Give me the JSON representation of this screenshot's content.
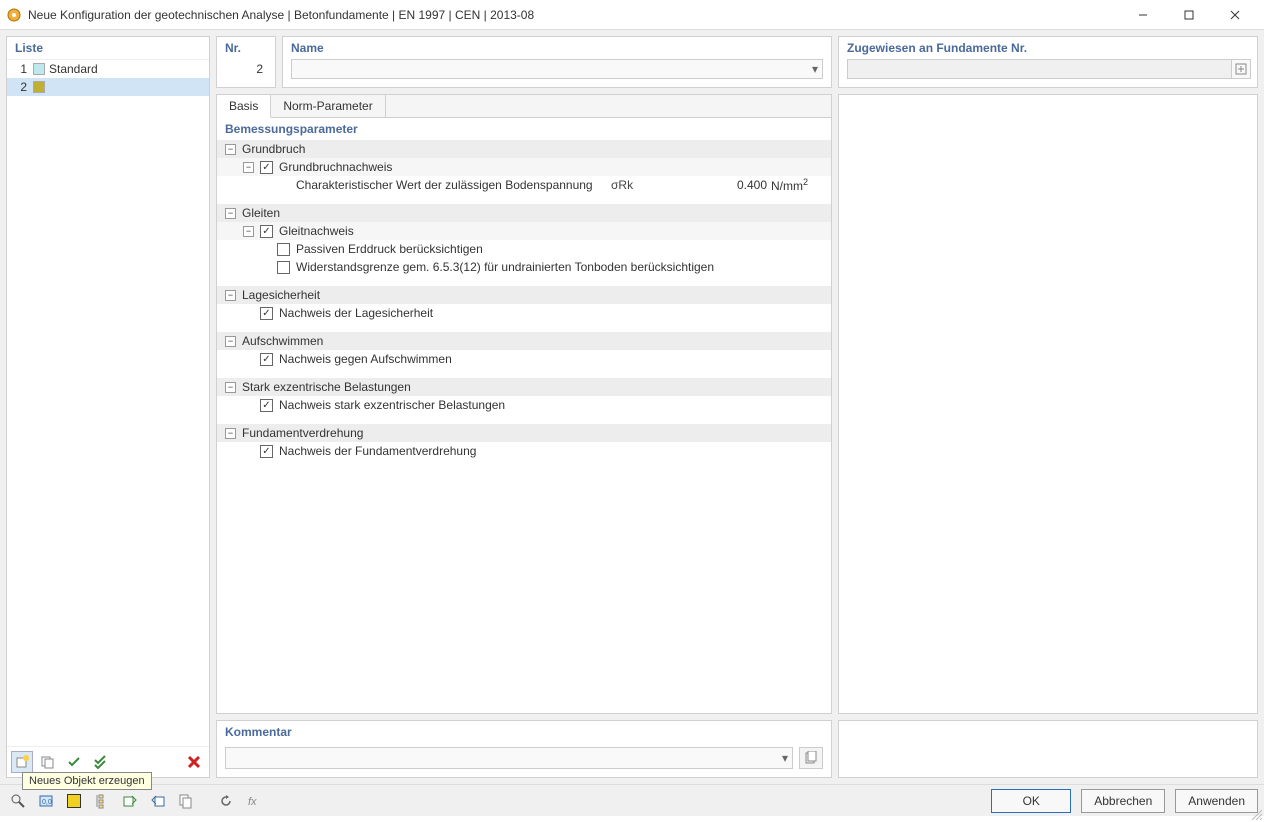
{
  "window": {
    "title": "Neue Konfiguration der geotechnischen Analyse | Betonfundamente | EN 1997 | CEN | 2013-08"
  },
  "sidebar": {
    "heading": "Liste",
    "items": [
      {
        "num": "1",
        "name": "Standard",
        "color": "#bfe8ee"
      },
      {
        "num": "2",
        "name": "",
        "color": "#c0b030"
      }
    ],
    "tooltip": "Neues Objekt erzeugen"
  },
  "header": {
    "nr_label": "Nr.",
    "nr_value": "2",
    "name_label": "Name",
    "name_value": "",
    "assigned_label": "Zugewiesen an Fundamente Nr.",
    "assigned_value": ""
  },
  "tabs": {
    "basis": "Basis",
    "norm": "Norm-Parameter"
  },
  "params": {
    "section_title": "Bemessungsparameter",
    "groups": [
      {
        "title": "Grundbruch",
        "rows": [
          {
            "type": "check",
            "checked": true,
            "label": "Grundbruchnachweis",
            "hasChildren": true
          },
          {
            "type": "value",
            "label": "Charakteristischer Wert der zulässigen Bodenspannung",
            "symbol": "σRk",
            "value": "0.400",
            "unit": "N/mm²"
          }
        ]
      },
      {
        "title": "Gleiten",
        "rows": [
          {
            "type": "check",
            "checked": true,
            "label": "Gleitnachweis",
            "hasChildren": true
          },
          {
            "type": "check",
            "checked": false,
            "label": "Passiven Erddruck berücksichtigen"
          },
          {
            "type": "check",
            "checked": false,
            "label": "Widerstandsgrenze gem. 6.5.3(12) für undrainierten Tonboden berücksichtigen"
          }
        ]
      },
      {
        "title": "Lagesicherheit",
        "rows": [
          {
            "type": "check",
            "checked": true,
            "label": "Nachweis der Lagesicherheit"
          }
        ]
      },
      {
        "title": "Aufschwimmen",
        "rows": [
          {
            "type": "check",
            "checked": true,
            "label": "Nachweis gegen Aufschwimmen"
          }
        ]
      },
      {
        "title": "Stark exzentrische Belastungen",
        "rows": [
          {
            "type": "check",
            "checked": true,
            "label": "Nachweis stark exzentrischer Belastungen"
          }
        ]
      },
      {
        "title": "Fundamentverdrehung",
        "rows": [
          {
            "type": "check",
            "checked": true,
            "label": "Nachweis der Fundamentverdrehung"
          }
        ]
      }
    ]
  },
  "comment": {
    "label": "Kommentar",
    "value": ""
  },
  "buttons": {
    "ok": "OK",
    "cancel": "Abbrechen",
    "apply": "Anwenden"
  }
}
